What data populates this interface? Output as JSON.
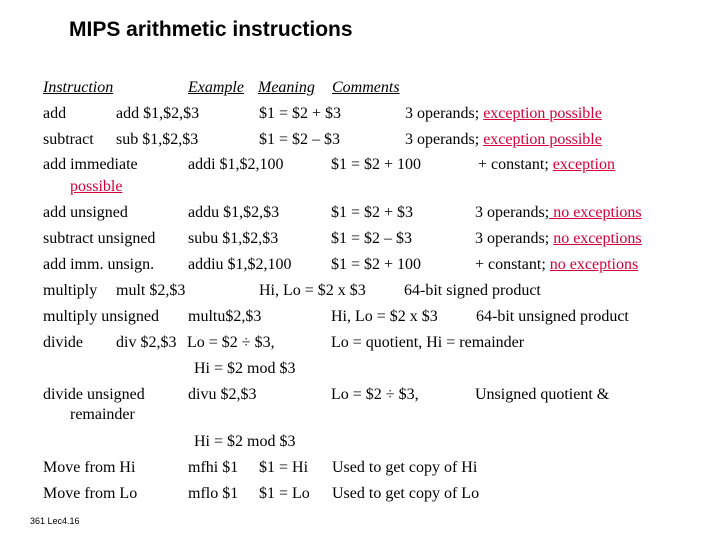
{
  "title": "MIPS arithmetic instructions",
  "header": {
    "instruction": "Instruction",
    "example": "Example",
    "meaning": "Meaning",
    "comments": "Comments"
  },
  "rows": [
    {
      "instr": "add",
      "example": "add $1,$2,$3",
      "meaning": "$1 = $2 + $3",
      "comment": "3 operands; ",
      "comment_red": "exception possible"
    },
    {
      "instr": "subtract",
      "example": "sub $1,$2,$3",
      "meaning": "$1 = $2 – $3",
      "comment": "3 operands; ",
      "comment_red": "exception possible"
    },
    {
      "instr": "add immediate",
      "example": "addi $1,$2,100",
      "meaning": "$1 = $2 + 100",
      "comment": "+ constant; ",
      "comment_red": "exception",
      "wrap_red": "possible"
    },
    {
      "instr": "add unsigned",
      "example": "addu $1,$2,$3",
      "meaning": "$1 = $2 + $3",
      "comment": "3 operands;",
      "comment_red": " no exceptions"
    },
    {
      "instr": "subtract unsigned",
      "example": "subu $1,$2,$3",
      "meaning": "$1 = $2 – $3",
      "comment": "3 operands; ",
      "comment_red": "no exceptions"
    },
    {
      "instr": "add imm. unsign.",
      "example": "addiu $1,$2,100",
      "meaning": "$1 = $2 + 100",
      "comment": "+ constant; ",
      "comment_red": "no exceptions"
    },
    {
      "instr": "multiply",
      "example": "mult $2,$3",
      "meaning": "Hi, Lo = $2 x $3",
      "comment": "64-bit signed product"
    },
    {
      "instr": "multiply unsigned",
      "example": "multu$2,$3",
      "meaning": "Hi, Lo = $2 x $3",
      "comment": "64-bit unsigned product"
    },
    {
      "instr": "divide",
      "example": "div $2,$3",
      "meaning": "Lo = $2 ÷ $3,",
      "comment": "Lo = quotient, Hi = remainder",
      "meaning2": "Hi = $2 mod $3"
    },
    {
      "instr": "divide unsigned",
      "instr2": "remainder",
      "example": "divu $2,$3",
      "meaning": "Lo = $2 ÷ $3,",
      "comment": "Unsigned quotient &",
      "meaning2": "Hi = $2 mod $3"
    },
    {
      "instr": "Move from Hi",
      "example": "mfhi $1",
      "meaning": "$1 = Hi",
      "comment": "Used to get copy of Hi"
    },
    {
      "instr": "Move from Lo",
      "example": "mflo $1",
      "meaning": "$1 = Lo",
      "comment": "Used to get copy of Lo"
    }
  ],
  "footer": "361  Lec4.16"
}
